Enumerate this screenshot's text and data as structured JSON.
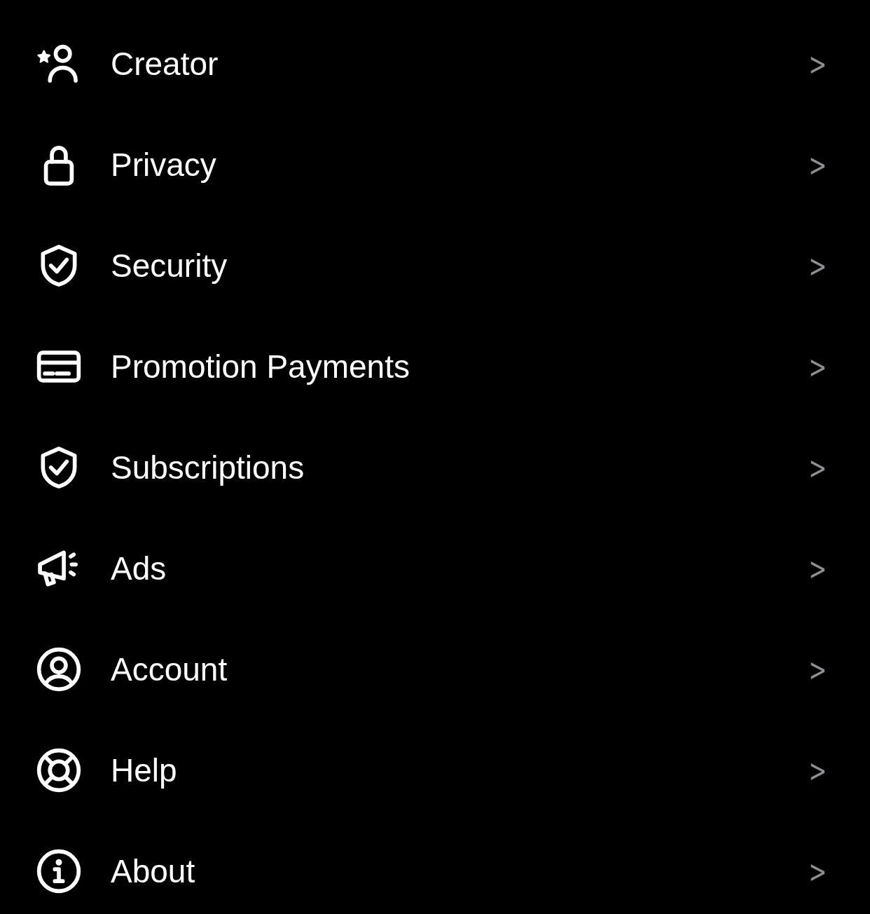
{
  "menu": {
    "items": [
      {
        "label": "Creator",
        "chevron": ">"
      },
      {
        "label": "Privacy",
        "chevron": ">"
      },
      {
        "label": "Security",
        "chevron": ">"
      },
      {
        "label": "Promotion Payments",
        "chevron": ">"
      },
      {
        "label": "Subscriptions",
        "chevron": ">"
      },
      {
        "label": "Ads",
        "chevron": ">"
      },
      {
        "label": "Account",
        "chevron": ">"
      },
      {
        "label": "Help",
        "chevron": ">"
      },
      {
        "label": "About",
        "chevron": ">"
      }
    ]
  }
}
